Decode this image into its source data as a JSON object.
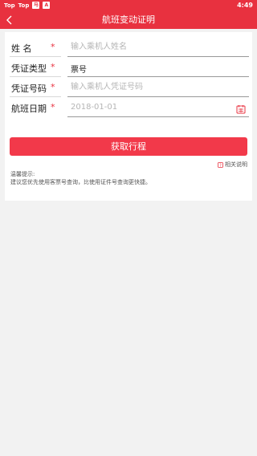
{
  "status_bar": {
    "left_items": [
      "Top",
      "Top"
    ],
    "app_icon_1": "马",
    "app_icon_2": "A",
    "time": "4:49"
  },
  "header": {
    "title": "航班变动证明",
    "back_icon": "chevron-left-icon"
  },
  "form": {
    "name": {
      "label": "姓    名",
      "required_mark": "*",
      "placeholder": "输入乘机人姓名"
    },
    "doc_type": {
      "label": "凭证类型",
      "required_mark": "*",
      "value": "票号"
    },
    "doc_number": {
      "label": "凭证号码",
      "required_mark": "*",
      "placeholder": "输入乘机人凭证号码"
    },
    "flight_date": {
      "label": "航班日期",
      "required_mark": "*",
      "value": "2018-01-01",
      "icon": "calendar-icon"
    }
  },
  "actions": {
    "submit_label": "获取行程",
    "help_label": "相关说明"
  },
  "tips": {
    "title": "温馨提示:",
    "text": "建议您优先使用客票号查询，比使用证件号查询更快捷。"
  },
  "colors": {
    "brand": "#e8313f",
    "button": "#f2394a"
  }
}
